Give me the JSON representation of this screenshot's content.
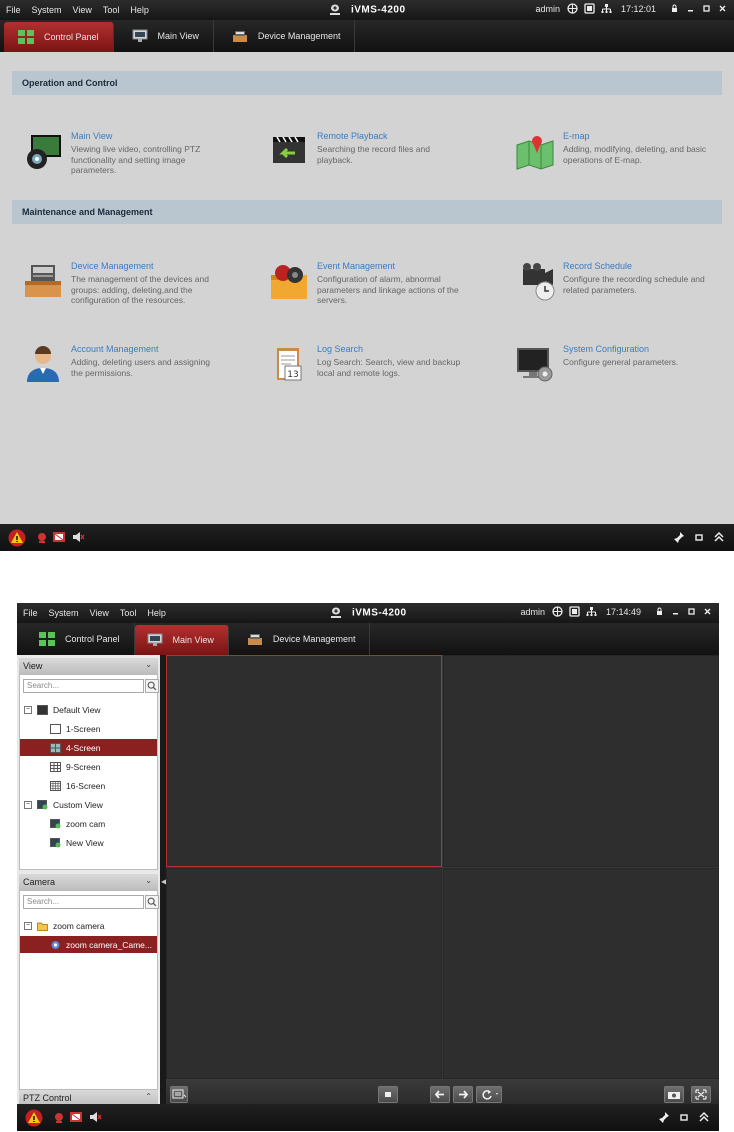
{
  "menu": [
    "File",
    "System",
    "View",
    "Tool",
    "Help"
  ],
  "app_title": "iVMS-4200",
  "user": "admin",
  "clock_top": "17:12:01",
  "clock_bottom": "17:14:49",
  "tabs": [
    "Control Panel",
    "Main View",
    "Device Management"
  ],
  "operation_header": "Operation and Control",
  "maintenance_header": "Maintenance and Management",
  "items": {
    "main_view": {
      "name": "Main View",
      "desc": "Viewing live video, controlling PTZ functionality and setting image parameters."
    },
    "remote_playback": {
      "name": "Remote Playback",
      "desc": "Searching the record files and playback."
    },
    "emap": {
      "name": "E-map",
      "desc": "Adding, modifying, deleting, and basic operations of E-map."
    },
    "device_management": {
      "name": "Device Management",
      "desc": "The management of the devices and groups: adding, deleting,and the configuration of the resources."
    },
    "event_management": {
      "name": "Event Management",
      "desc": "Configuration of alarm, abnormal parameters and linkage actions of the servers."
    },
    "record_schedule": {
      "name": "Record Schedule",
      "desc": "Configure the recording schedule and related parameters."
    },
    "account_management": {
      "name": "Account Management",
      "desc": "Adding, deleting users and assigning the permissions."
    },
    "log_search": {
      "name": "Log Search",
      "desc": "Log Search: Search, view and backup local and remote logs."
    },
    "system_configuration": {
      "name": "System Configuration",
      "desc": "Configure general parameters."
    }
  },
  "view_panel": {
    "title": "View",
    "search_placeholder": "Search...",
    "default_view": "Default View",
    "screens": [
      "1-Screen",
      "4-Screen",
      "9-Screen",
      "16-Screen"
    ],
    "custom_view": "Custom View",
    "custom_items": [
      "zoom cam",
      "New View"
    ]
  },
  "camera_panel": {
    "title": "Camera",
    "search_placeholder": "Search...",
    "group": "zoom camera",
    "camera": "zoom camera_Came..."
  },
  "ptz_control": "PTZ Control",
  "colors": {
    "accent": "#a52a2a",
    "link": "#3a7cc2",
    "panel_bg": "#d3d3d3"
  }
}
